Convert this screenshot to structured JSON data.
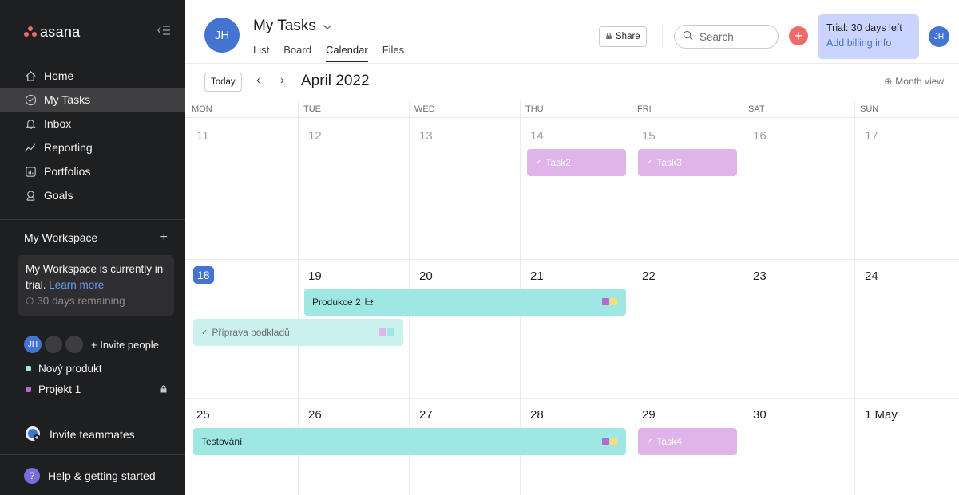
{
  "sidebar": {
    "logo": "asana",
    "nav": [
      {
        "label": "Home",
        "icon": "home-icon"
      },
      {
        "label": "My Tasks",
        "icon": "check-circle-icon"
      },
      {
        "label": "Inbox",
        "icon": "bell-icon"
      },
      {
        "label": "Reporting",
        "icon": "reporting-icon"
      },
      {
        "label": "Portfolios",
        "icon": "portfolio-icon"
      },
      {
        "label": "Goals",
        "icon": "goals-icon"
      }
    ],
    "workspace_label": "My Workspace",
    "trial_text": "My Workspace is currently in trial.",
    "learn_more": "Learn more",
    "days_remaining": "30 days remaining",
    "user_initials": "JH",
    "invite_people": "+ Invite people",
    "projects": [
      {
        "name": "Nový produkt",
        "color": "#9ee7e3"
      },
      {
        "name": "Projekt 1",
        "color": "#b36bd4"
      }
    ],
    "invite_teammates": "Invite teammates",
    "help": "Help & getting started"
  },
  "header": {
    "avatar_initials": "JH",
    "title": "My Tasks",
    "tabs": [
      "List",
      "Board",
      "Calendar",
      "Files"
    ],
    "active_tab": "Calendar",
    "share": "Share",
    "search_placeholder": "Search",
    "trial_days": "Trial: 30 days left",
    "billing": "Add billing info",
    "user_initials": "JH"
  },
  "toolbar": {
    "today": "Today",
    "month": "April 2022",
    "view": "Month view"
  },
  "calendar": {
    "days_of_week": [
      "MON",
      "TUE",
      "WED",
      "THU",
      "FRI",
      "SAT",
      "SUN"
    ],
    "weeks": [
      [
        "11",
        "12",
        "13",
        "14",
        "15",
        "16",
        "17"
      ],
      [
        "18",
        "19",
        "20",
        "21",
        "22",
        "23",
        "24"
      ],
      [
        "25",
        "26",
        "27",
        "28",
        "29",
        "30",
        "1 May"
      ]
    ],
    "today": "18",
    "tasks": {
      "task2": "Task2",
      "task3": "Task3",
      "produkce": "Produkce 2",
      "priprava": "Příprava podkladů",
      "testovani": "Testování",
      "task4": "Task4"
    },
    "colors": {
      "purple": "#dfb4e9",
      "teal": "#9ee7e3",
      "tag_purple": "#b36bd4",
      "tag_yellow": "#f8df72"
    }
  }
}
